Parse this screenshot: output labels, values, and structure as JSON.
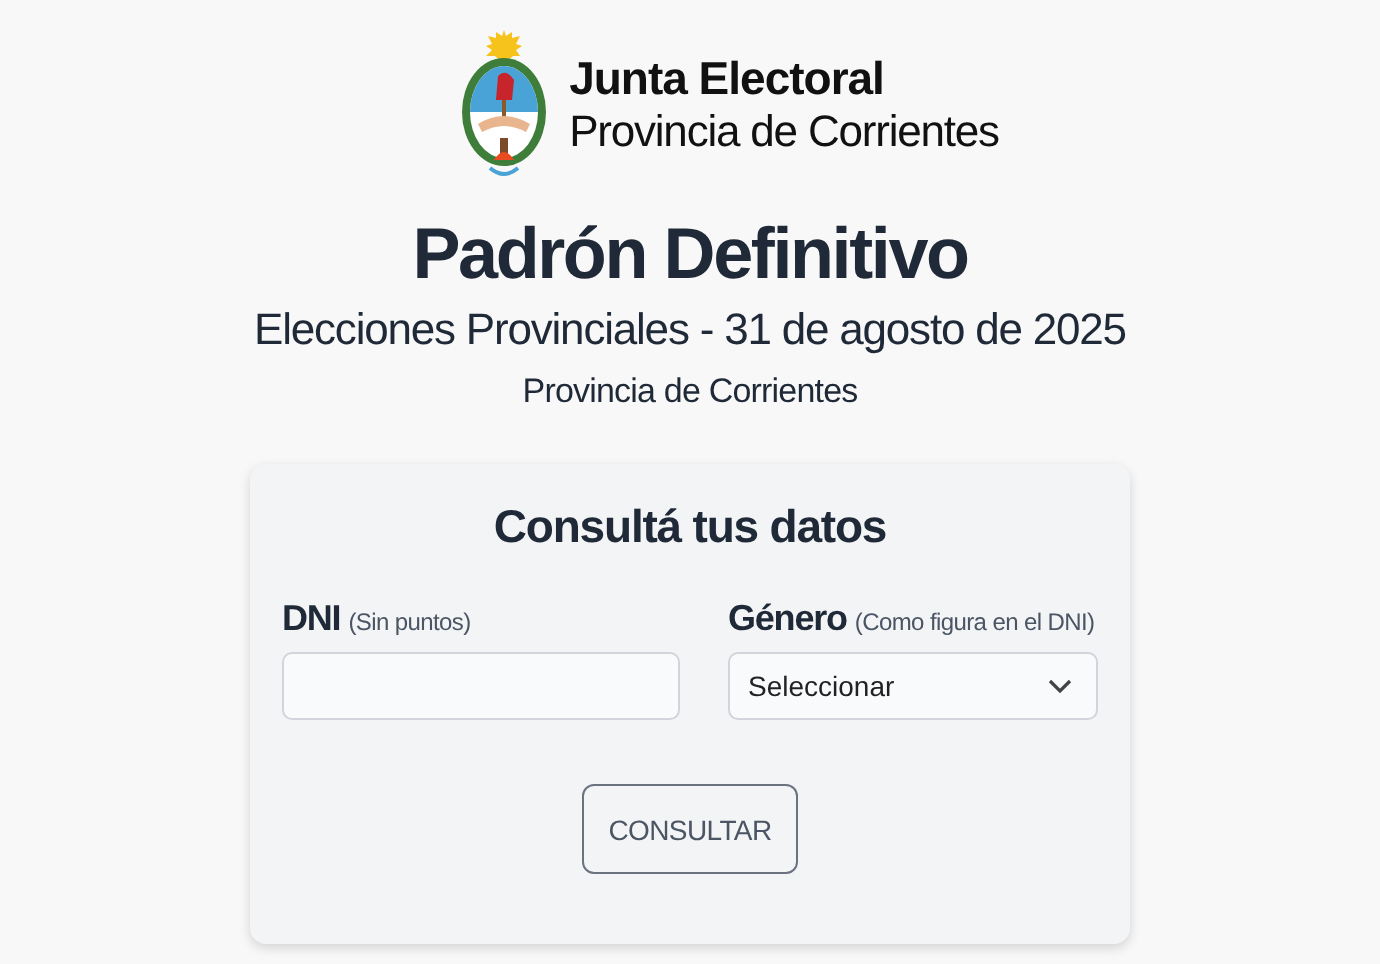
{
  "header": {
    "org_name": "Junta Electoral",
    "org_region": "Provincia de Corrientes"
  },
  "title": "Padrón Definitivo",
  "subtitle": "Elecciones Provinciales - 31 de agosto de 2025",
  "region": "Provincia de Corrientes",
  "form": {
    "heading": "Consultá tus datos",
    "fields": [
      {
        "kind": "text",
        "label": "DNI",
        "hint": "(Sin puntos)"
      },
      {
        "kind": "select",
        "label": "Género",
        "hint": "(Como figura en el DNI)",
        "value": "Seleccionar"
      }
    ],
    "button": "CONSULTAR"
  }
}
